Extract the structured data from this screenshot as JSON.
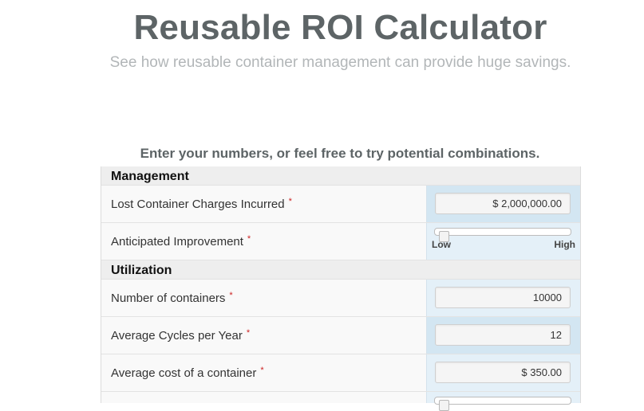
{
  "header": {
    "title": "Reusable ROI Calculator",
    "subtitle": "See how reusable container management can provide huge savings.",
    "instructions": "Enter your numbers, or feel free to try potential combinations."
  },
  "required_marker": "*",
  "sections": {
    "management": {
      "title": "Management",
      "lost_charges": {
        "label": "Lost Container Charges Incurred",
        "value": "$ 2,000,000.00"
      },
      "improvement": {
        "label": "Anticipated Improvement",
        "low": "Low",
        "high": "High",
        "level": 0.0
      }
    },
    "utilization": {
      "title": "Utilization",
      "containers": {
        "label": "Number of containers",
        "value": "10000"
      },
      "cycles": {
        "label": "Average Cycles per Year",
        "value": "12"
      },
      "cost": {
        "label": "Average cost of a container",
        "value": "$ 350.00"
      }
    }
  },
  "colors": {
    "title": "#5d6466",
    "subtitle": "#b2b6b8",
    "input_panel": "#e4f0f8",
    "required": "#cc2222"
  }
}
